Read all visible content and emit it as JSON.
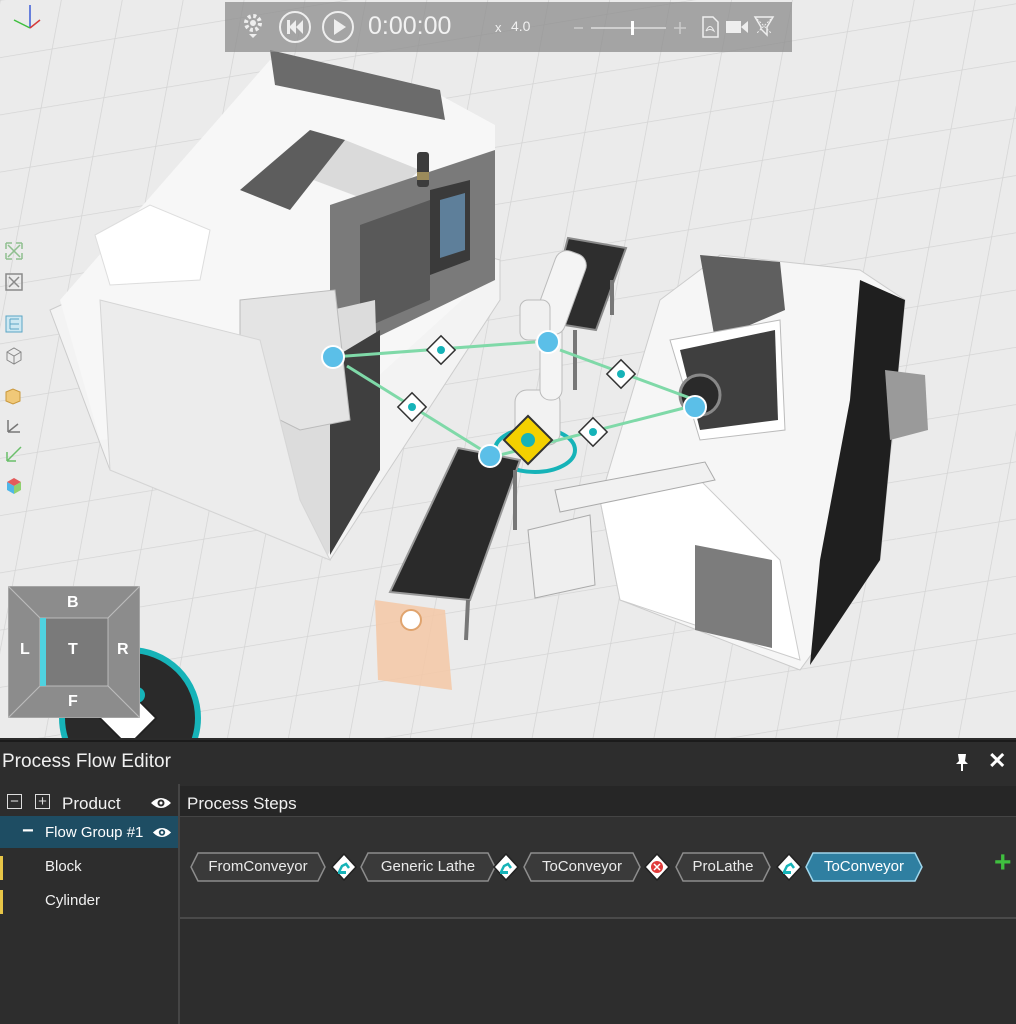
{
  "playback": {
    "timer": "0:00:00",
    "speed_prefix": "x",
    "speed": "4.0"
  },
  "navcube": {
    "top": "T",
    "back": "B",
    "left": "L",
    "right": "R",
    "front": "F"
  },
  "panel": {
    "title": "Process Flow Editor"
  },
  "tree": {
    "header": "Product",
    "flow_group": "Flow Group #1",
    "items": [
      {
        "label": "Block",
        "color": "#e7c547"
      },
      {
        "label": "Cylinder",
        "color": "#e7c547"
      }
    ]
  },
  "steps": {
    "title": "Process Steps",
    "items": [
      {
        "label": "FromConveyor",
        "selected": false
      },
      {
        "label": "Generic Lathe",
        "selected": false
      },
      {
        "label": "ToConveyor",
        "selected": false
      },
      {
        "label": "ProLathe",
        "selected": false
      },
      {
        "label": "ToConveyor",
        "selected": true
      }
    ],
    "transitions": [
      "robot-icon",
      "robot-icon",
      "robot-error-icon",
      "robot-icon"
    ]
  },
  "colors": {
    "accent": "#5bbfe8",
    "selected_step": "#2f7fa1",
    "flow_line": "#7fd9a8",
    "add": "#3fbf3f"
  }
}
